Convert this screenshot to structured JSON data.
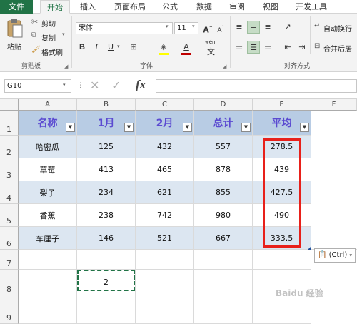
{
  "tabs": [
    "文件",
    "开始",
    "插入",
    "页面布局",
    "公式",
    "数据",
    "审阅",
    "视图",
    "开发工具"
  ],
  "clipboard": {
    "paste": "粘贴",
    "cut": "剪切",
    "copy": "复制",
    "format_painter": "格式刷",
    "group": "剪贴板"
  },
  "font": {
    "name": "宋体",
    "size": "11",
    "bold": "B",
    "italic": "I",
    "underline": "U",
    "wen": "wén",
    "wen2": "文",
    "group": "字体"
  },
  "alignment": {
    "wrap": "自动换行",
    "merge": "合并后居",
    "group": "对齐方式"
  },
  "formula_bar": {
    "name_box": "G10",
    "fx": "fx",
    "value": ""
  },
  "columns": [
    "A",
    "B",
    "C",
    "D",
    "E",
    "F"
  ],
  "rows": [
    "1",
    "2",
    "3",
    "4",
    "5",
    "6",
    "7",
    "8",
    "9"
  ],
  "table": {
    "headers": [
      "名称",
      "1月",
      "2月",
      "总计",
      "平均"
    ],
    "rows": [
      [
        "哈密瓜",
        "125",
        "432",
        "557",
        "278.5"
      ],
      [
        "草莓",
        "413",
        "465",
        "878",
        "439"
      ],
      [
        "梨子",
        "234",
        "621",
        "855",
        "427.5"
      ],
      [
        "香蕉",
        "238",
        "742",
        "980",
        "490"
      ],
      [
        "车厘子",
        "146",
        "521",
        "667",
        "333.5"
      ]
    ]
  },
  "copied_cell": "2",
  "paste_options": "(Ctrl)",
  "watermark": "Baidu 经验",
  "colors": {
    "accent": "#217346",
    "header_band": "#b8cce4",
    "row_band": "#dce6f1",
    "header_text": "#5b4ad1",
    "highlight": "#e8201a"
  }
}
